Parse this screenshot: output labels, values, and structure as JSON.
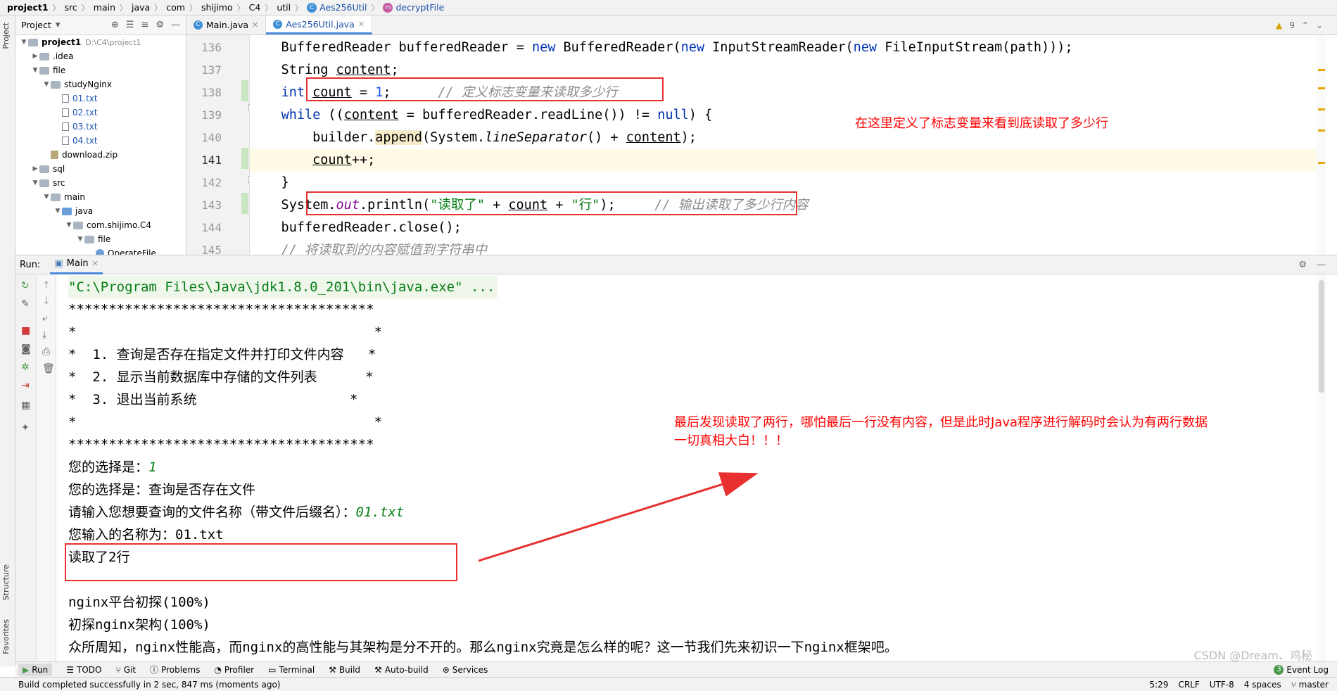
{
  "breadcrumb": [
    "project1",
    "src",
    "main",
    "java",
    "com",
    "shijimo",
    "C4",
    "util",
    "Aes256Util",
    "decryptFile"
  ],
  "project_panel": {
    "title": "Project",
    "tree": [
      {
        "label": "project1",
        "extra": "D:\\C4\\project1",
        "depth": 0,
        "type": "root",
        "open": true
      },
      {
        "label": ".idea",
        "depth": 1,
        "type": "folder",
        "open": false
      },
      {
        "label": "file",
        "depth": 1,
        "type": "folder",
        "open": true
      },
      {
        "label": "studyNginx",
        "depth": 2,
        "type": "folder",
        "open": true
      },
      {
        "label": "01.txt",
        "depth": 3,
        "type": "file"
      },
      {
        "label": "02.txt",
        "depth": 3,
        "type": "file"
      },
      {
        "label": "03.txt",
        "depth": 3,
        "type": "file"
      },
      {
        "label": "04.txt",
        "depth": 3,
        "type": "file"
      },
      {
        "label": "download.zip",
        "depth": 2,
        "type": "zip"
      },
      {
        "label": "sql",
        "depth": 1,
        "type": "folder",
        "open": false
      },
      {
        "label": "src",
        "depth": 1,
        "type": "folder",
        "open": true
      },
      {
        "label": "main",
        "depth": 2,
        "type": "folder",
        "open": true
      },
      {
        "label": "java",
        "depth": 3,
        "type": "bluefolder",
        "open": true
      },
      {
        "label": "com.shijimo.C4",
        "depth": 4,
        "type": "folder",
        "open": true
      },
      {
        "label": "file",
        "depth": 5,
        "type": "folder",
        "open": true
      },
      {
        "label": "OperateFile",
        "depth": 6,
        "type": "class"
      }
    ]
  },
  "editor_tabs": [
    {
      "label": "Main.java",
      "active": false
    },
    {
      "label": "Aes256Util.java",
      "active": true
    }
  ],
  "inspection": {
    "warning_count": "9"
  },
  "line_numbers": [
    "136",
    "137",
    "138",
    "139",
    "140",
    "141",
    "142",
    "143",
    "144",
    "145"
  ],
  "annotations": {
    "code_note": "在这里定义了标志变量来看到底读取了多少行",
    "console_note_line1": "最后发现读取了两行，哪怕最后一行没有内容，但是此时Java程序进行解码时会认为有两行数据",
    "console_note_line2": "一切真相大白！！！"
  },
  "run_panel": {
    "label": "Run:",
    "tab": "Main",
    "console": {
      "cmd": "\"C:\\Program Files\\Java\\jdk1.8.0_201\\bin\\java.exe\" ...",
      "stars": "**************************************",
      "blank": "*                                     *",
      "menu1": "*  1. 查询是否存在指定文件并打印文件内容   *",
      "menu2": "*  2. 显示当前数据库中存储的文件列表      *",
      "menu3": "*  3. 退出当前系统                   *",
      "choice_label": "您的选择是：",
      "choice_value": "1",
      "choice_desc": "您的选择是：查询是否存在文件",
      "prompt_label": "请输入您想要查询的文件名称（带文件后缀名）：",
      "prompt_value": "01.txt",
      "entered": "您输入的名称为：01.txt",
      "read_result": "读取了2行",
      "out1": "nginx平台初探(100%)",
      "out2": "初探nginx架构(100%)",
      "out3": "众所周知，nginx性能高，而nginx的高性能与其架构是分不开的。那么nginx究竟是怎么样的呢？这一节我们先来初识一下nginx框架吧。"
    }
  },
  "tool_windows": [
    "Run",
    "TODO",
    "Git",
    "Problems",
    "Profiler",
    "Terminal",
    "Build",
    "Auto-build",
    "Services"
  ],
  "side_tabs": {
    "top": "Project",
    "structure": "Structure",
    "favorites": "Favorites"
  },
  "event_log": "Event Log",
  "event_count": "3",
  "status": {
    "message": "Build completed successfully in 2 sec, 847 ms (moments ago)",
    "position": "5:29",
    "line_sep": "CRLF",
    "encoding": "UTF-8",
    "indent": "4 spaces",
    "branch": "master"
  },
  "watermark": "CSDN @Dream、鸡秘"
}
